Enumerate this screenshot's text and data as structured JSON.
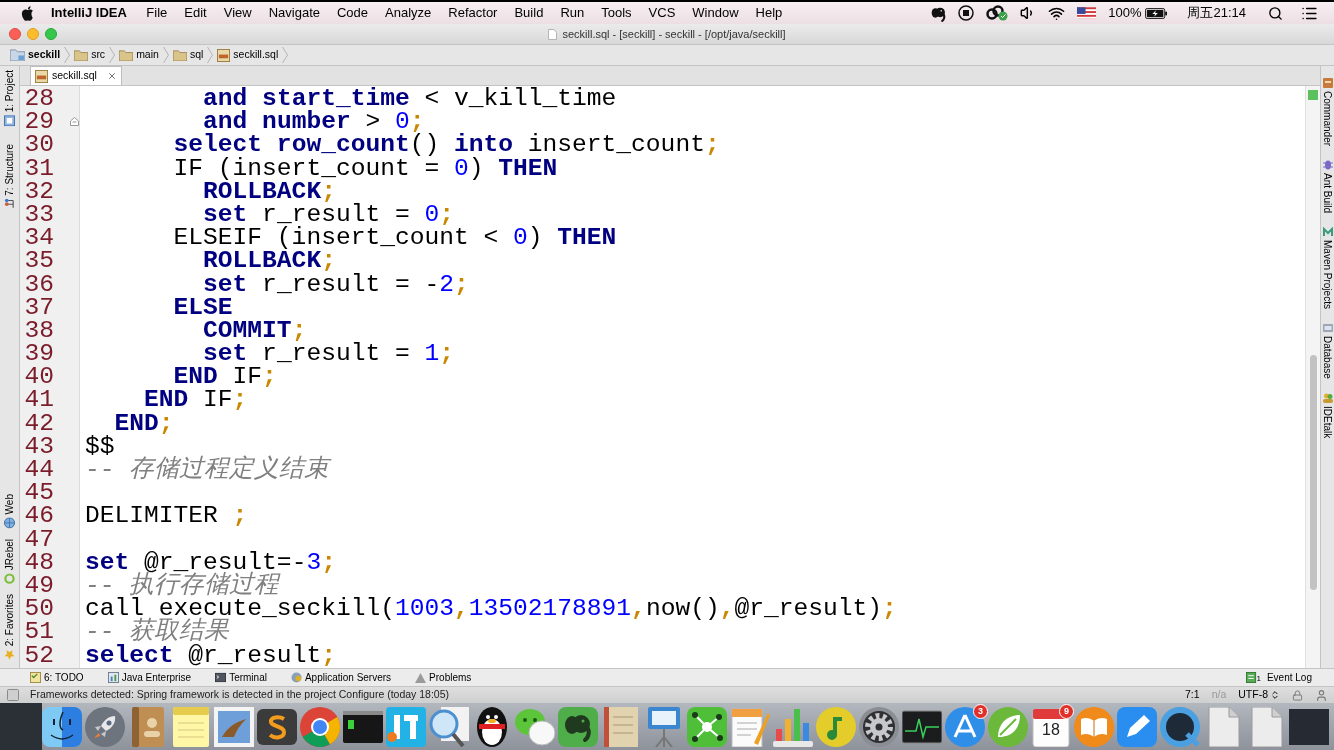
{
  "menu_bar": {
    "app_name": "IntelliJ IDEA",
    "menus": [
      "File",
      "Edit",
      "View",
      "Navigate",
      "Code",
      "Analyze",
      "Refactor",
      "Build",
      "Run",
      "Tools",
      "VCS",
      "Window",
      "Help"
    ],
    "battery": "100%",
    "clock": "周五21:14"
  },
  "window": {
    "title": "seckill.sql - [seckill] - seckill - [/opt/java/seckill]"
  },
  "breadcrumbs": [
    {
      "label": "seckill",
      "kind": "project"
    },
    {
      "label": "src",
      "kind": "folder"
    },
    {
      "label": "main",
      "kind": "folder"
    },
    {
      "label": "sql",
      "kind": "folder"
    },
    {
      "label": "seckill.sql",
      "kind": "file"
    }
  ],
  "left_tool_stripe": {
    "top": [
      "1: Project",
      "7: Structure"
    ],
    "bottom": [
      "Web",
      "JRebel",
      "2: Favorites"
    ]
  },
  "tabs": [
    {
      "label": "seckill.sql",
      "selected": true
    }
  ],
  "editor": {
    "lines": [
      {
        "number": "28",
        "fold_end": false,
        "tokens": [
          {
            "kind": "keyword",
            "text": "        and"
          },
          {
            "kind": "keyword",
            "text": " start_time"
          },
          {
            "kind": "plain",
            "text": " < v_kill_time"
          }
        ]
      },
      {
        "number": "29",
        "fold_end": true,
        "tokens": [
          {
            "kind": "keyword",
            "text": "        and"
          },
          {
            "kind": "keyword",
            "text": " number"
          },
          {
            "kind": "plain",
            "text": " > "
          },
          {
            "kind": "number",
            "text": "0"
          },
          {
            "kind": "punctuation",
            "text": ";"
          }
        ]
      },
      {
        "number": "30",
        "fold_end": false,
        "tokens": [
          {
            "kind": "keyword",
            "text": "      select"
          },
          {
            "kind": "keyword",
            "text": " row_count"
          },
          {
            "kind": "plain",
            "text": "() "
          },
          {
            "kind": "keyword",
            "text": "into"
          },
          {
            "kind": "plain",
            "text": " insert_count"
          },
          {
            "kind": "punctuation",
            "text": ";"
          }
        ]
      },
      {
        "number": "31",
        "fold_end": false,
        "tokens": [
          {
            "kind": "plain",
            "text": "      IF (insert_count = "
          },
          {
            "kind": "number",
            "text": "0"
          },
          {
            "kind": "plain",
            "text": ") "
          },
          {
            "kind": "keyword",
            "text": "THEN"
          }
        ]
      },
      {
        "number": "32",
        "fold_end": false,
        "tokens": [
          {
            "kind": "keyword",
            "text": "        ROLLBACK"
          },
          {
            "kind": "punctuation",
            "text": ";"
          }
        ]
      },
      {
        "number": "33",
        "fold_end": false,
        "tokens": [
          {
            "kind": "keyword",
            "text": "        set"
          },
          {
            "kind": "plain",
            "text": " r_result = "
          },
          {
            "kind": "number",
            "text": "0"
          },
          {
            "kind": "punctuation",
            "text": ";"
          }
        ]
      },
      {
        "number": "34",
        "fold_end": false,
        "tokens": [
          {
            "kind": "plain",
            "text": "      ELSEIF (insert_count < "
          },
          {
            "kind": "number",
            "text": "0"
          },
          {
            "kind": "plain",
            "text": ") "
          },
          {
            "kind": "keyword",
            "text": "THEN"
          }
        ]
      },
      {
        "number": "35",
        "fold_end": false,
        "tokens": [
          {
            "kind": "keyword",
            "text": "        ROLLBACK"
          },
          {
            "kind": "punctuation",
            "text": ";"
          }
        ]
      },
      {
        "number": "36",
        "fold_end": false,
        "tokens": [
          {
            "kind": "keyword",
            "text": "        set"
          },
          {
            "kind": "plain",
            "text": " r_result = -"
          },
          {
            "kind": "number",
            "text": "2"
          },
          {
            "kind": "punctuation",
            "text": ";"
          }
        ]
      },
      {
        "number": "37",
        "fold_end": false,
        "tokens": [
          {
            "kind": "keyword",
            "text": "      ELSE"
          }
        ]
      },
      {
        "number": "38",
        "fold_end": false,
        "tokens": [
          {
            "kind": "keyword",
            "text": "        COMMIT"
          },
          {
            "kind": "punctuation",
            "text": ";"
          }
        ]
      },
      {
        "number": "39",
        "fold_end": false,
        "tokens": [
          {
            "kind": "keyword",
            "text": "        set"
          },
          {
            "kind": "plain",
            "text": " r_result = "
          },
          {
            "kind": "number",
            "text": "1"
          },
          {
            "kind": "punctuation",
            "text": ";"
          }
        ]
      },
      {
        "number": "40",
        "fold_end": false,
        "tokens": [
          {
            "kind": "keyword",
            "text": "      END"
          },
          {
            "kind": "plain",
            "text": " IF"
          },
          {
            "kind": "punctuation",
            "text": ";"
          }
        ]
      },
      {
        "number": "41",
        "fold_end": false,
        "tokens": [
          {
            "kind": "keyword",
            "text": "    END"
          },
          {
            "kind": "plain",
            "text": " IF"
          },
          {
            "kind": "punctuation",
            "text": ";"
          }
        ]
      },
      {
        "number": "42",
        "fold_end": false,
        "tokens": [
          {
            "kind": "keyword",
            "text": "  END"
          },
          {
            "kind": "punctuation",
            "text": ";"
          }
        ]
      },
      {
        "number": "43",
        "fold_end": false,
        "tokens": [
          {
            "kind": "plain",
            "text": "$$"
          }
        ]
      },
      {
        "number": "44",
        "fold_end": false,
        "tokens": [
          {
            "kind": "comment",
            "text": "-- 存储过程定义结束"
          }
        ]
      },
      {
        "number": "45",
        "fold_end": false
      },
      {
        "number": "46",
        "fold_end": false,
        "tokens": [
          {
            "kind": "plain",
            "text": "DELIMITER "
          },
          {
            "kind": "punctuation",
            "text": ";"
          }
        ]
      },
      {
        "number": "47",
        "fold_end": false
      },
      {
        "number": "48",
        "fold_end": false,
        "tokens": [
          {
            "kind": "keyword",
            "text": "set"
          },
          {
            "kind": "plain",
            "text": " @r_result=-"
          },
          {
            "kind": "number",
            "text": "3"
          },
          {
            "kind": "punctuation",
            "text": ";"
          }
        ]
      },
      {
        "number": "49",
        "fold_end": false,
        "tokens": [
          {
            "kind": "comment",
            "text": "-- 执行存储过程"
          }
        ]
      },
      {
        "number": "50",
        "fold_end": false,
        "tokens": [
          {
            "kind": "plain",
            "text": "call execute_seckill("
          },
          {
            "kind": "number",
            "text": "1003"
          },
          {
            "kind": "punctuation",
            "text": ","
          },
          {
            "kind": "number",
            "text": "13502178891"
          },
          {
            "kind": "punctuation",
            "text": ","
          },
          {
            "kind": "plain",
            "text": "now()"
          },
          {
            "kind": "punctuation",
            "text": ","
          },
          {
            "kind": "plain",
            "text": "@r_result)"
          },
          {
            "kind": "punctuation",
            "text": ";"
          }
        ]
      },
      {
        "number": "51",
        "fold_end": false,
        "tokens": [
          {
            "kind": "comment",
            "text": "-- 获取结果"
          }
        ]
      },
      {
        "number": "52",
        "fold_end": false,
        "tokens": [
          {
            "kind": "keyword",
            "text": "select"
          },
          {
            "kind": "plain",
            "text": " @r_result"
          },
          {
            "kind": "punctuation",
            "text": ";"
          }
        ]
      }
    ]
  },
  "right_tool_stripe": [
    "Commander",
    "Ant Build",
    "Maven Projects",
    "Database",
    "IDEtalk"
  ],
  "tool_window_bar": {
    "left": [
      "6: TODO",
      "Java Enterprise",
      "Terminal",
      "Application Servers",
      "Problems"
    ],
    "event_log": {
      "label": "Event Log",
      "count": "1"
    }
  },
  "status_bar": {
    "message": "Frameworks detected: Spring framework is detected in the project Configure (today 18:05)",
    "position": "7:1",
    "line_separator": "n/a",
    "encoding": "UTF-8"
  },
  "dock": [
    {
      "kind": "face"
    },
    {
      "kind": "rocket"
    },
    {
      "kind": "address-book"
    },
    {
      "kind": "notepad"
    },
    {
      "kind": "photo"
    },
    {
      "kind": "s-shape"
    },
    {
      "kind": "round-logo"
    },
    {
      "kind": "terminal"
    },
    {
      "kind": "tile-logo"
    },
    {
      "kind": "magnifier"
    },
    {
      "kind": "penguin"
    },
    {
      "kind": "chat"
    },
    {
      "kind": "elephant"
    },
    {
      "kind": "notebook"
    },
    {
      "kind": "presentation"
    },
    {
      "kind": "mind-map"
    },
    {
      "kind": "document-pen"
    },
    {
      "kind": "bar-chart"
    },
    {
      "kind": "music"
    },
    {
      "kind": "gear"
    },
    {
      "kind": "pulse"
    },
    {
      "kind": "app-store",
      "badge": "3"
    },
    {
      "kind": "leaf"
    },
    {
      "kind": "calendar",
      "date": "18",
      "badge": "9"
    },
    {
      "kind": "book"
    },
    {
      "kind": "pen"
    },
    {
      "kind": "q-ring"
    },
    {
      "kind": "document"
    },
    {
      "kind": "document"
    },
    {
      "kind": "window-thumbnail"
    }
  ]
}
